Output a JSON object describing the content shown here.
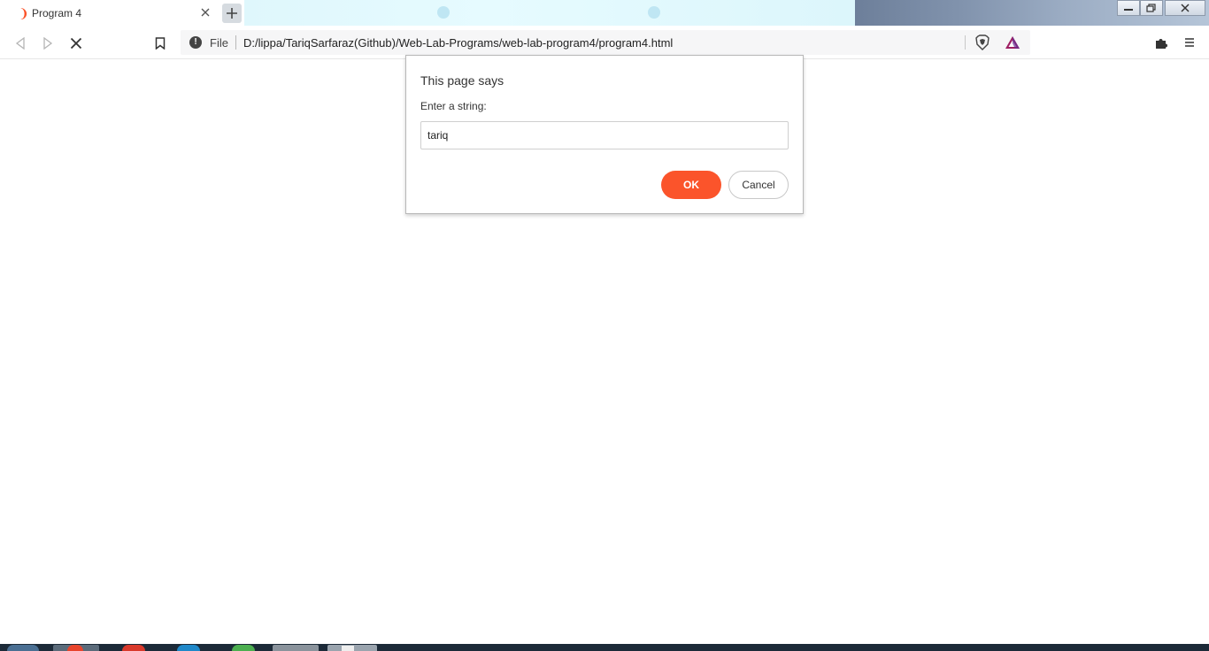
{
  "tab": {
    "title": "Program 4",
    "icon": "brave-lion-icon"
  },
  "toolbar": {
    "scheme_label": "File",
    "url": "D:/lippa/TariqSarfaraz(Github)/Web-Lab-Programs/web-lab-program4/program4.html"
  },
  "dialog": {
    "title": "This page says",
    "message": "Enter a string:",
    "input_value": "tariq",
    "ok_label": "OK",
    "cancel_label": "Cancel"
  },
  "colors": {
    "accent": "#fb542b",
    "toolbar_bg": "#ffffff",
    "urlbar_bg": "#f6f6f7"
  }
}
